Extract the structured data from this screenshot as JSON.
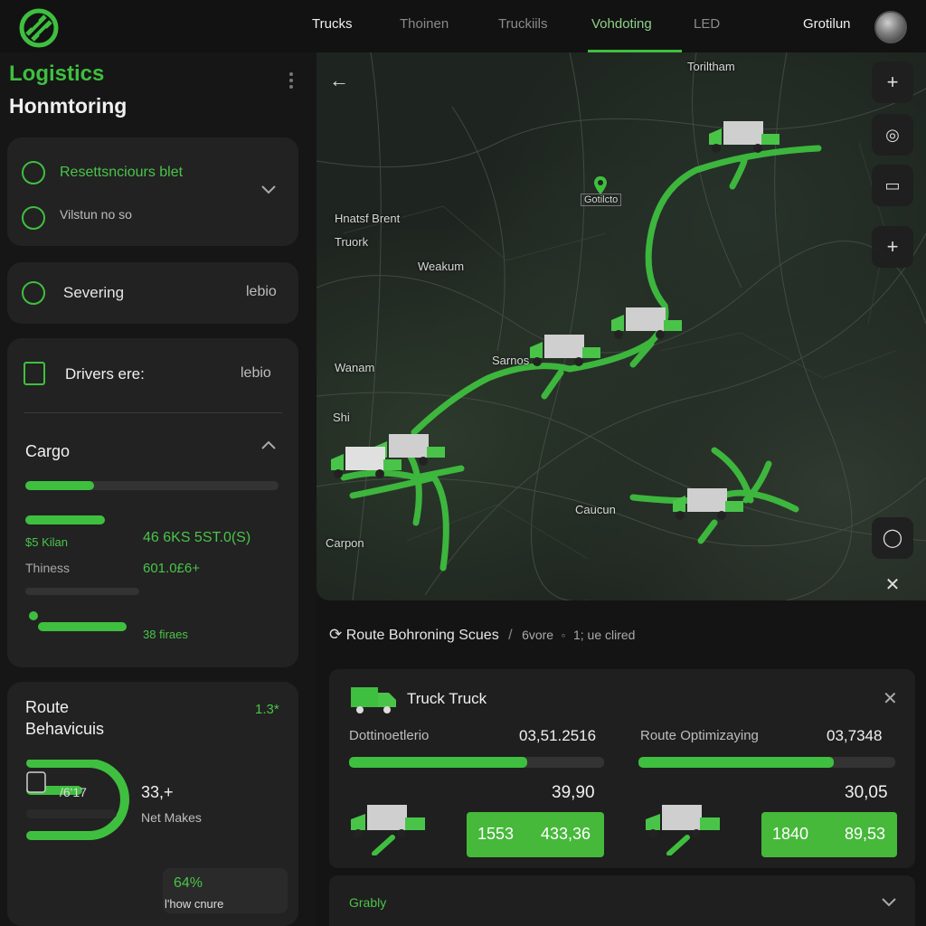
{
  "nav": {
    "tabs": [
      {
        "label": "Trucks"
      },
      {
        "label": "Thoinen"
      },
      {
        "label": "Truckiils"
      },
      {
        "label": "Vohdoting"
      },
      {
        "label": "LED"
      }
    ],
    "user_name": "Grotilun"
  },
  "sidebar": {
    "title_line1": "Logistics",
    "title_line2": "Honmtoring",
    "card1": {
      "heading": "Resettsnciours blet",
      "sub": "Vilstun no so"
    },
    "card2": {
      "label": "Severing",
      "value": "lebio"
    },
    "card3": {
      "drivers_label": "Drivers ere:",
      "drivers_value": "lebio",
      "cargo_label": "Cargo",
      "cargo_fill": 0.27,
      "row1_label": "$5 Kilan",
      "row1_value": "46 6KS 5ST.0(S)",
      "row2_label": "Thiness",
      "row2_value": "601.0£6+",
      "bottom_value": "38 firaes"
    },
    "card4": {
      "title_line1": "Route",
      "title_line2": "Behavicuis",
      "badge": "1.3*",
      "gauge_label": "/6'17",
      "metric_value": "33,+",
      "metric_label": "Net Makes",
      "inner_value": "64%",
      "inner_label": "l'how cnure"
    }
  },
  "map": {
    "labels": {
      "top_right": "Toriltham",
      "poi": "Gotilcto",
      "left1": "Hnatsf Brent",
      "left2": "Truork",
      "center": "Weakum",
      "mid": "Sarnos",
      "left3": "Wanam",
      "left4": "Shi",
      "bottom_left": "Carpon",
      "bottom_right": "Caucun"
    }
  },
  "route_panel": {
    "heading": "Route Bohroning Scues",
    "sep": "/",
    "link1": "6vore",
    "link2": "1; ue clired",
    "card": {
      "title": "Truck Truck",
      "left": {
        "label": "Dottinoetlerio",
        "value": "03,51.2516",
        "fill": 0.7,
        "sub_value": "39,90",
        "pill_a": "1553",
        "pill_b": "433,36"
      },
      "right": {
        "label": "Route Optimizaying",
        "value": "03,7348",
        "fill": 0.76,
        "sub_value": "30,05",
        "pill_a": "1840",
        "pill_b": "89,53"
      }
    },
    "bottom_card_label": "Grably"
  },
  "colors": {
    "accent": "#3fbf3f",
    "background": "#141414",
    "card": "#222222"
  }
}
